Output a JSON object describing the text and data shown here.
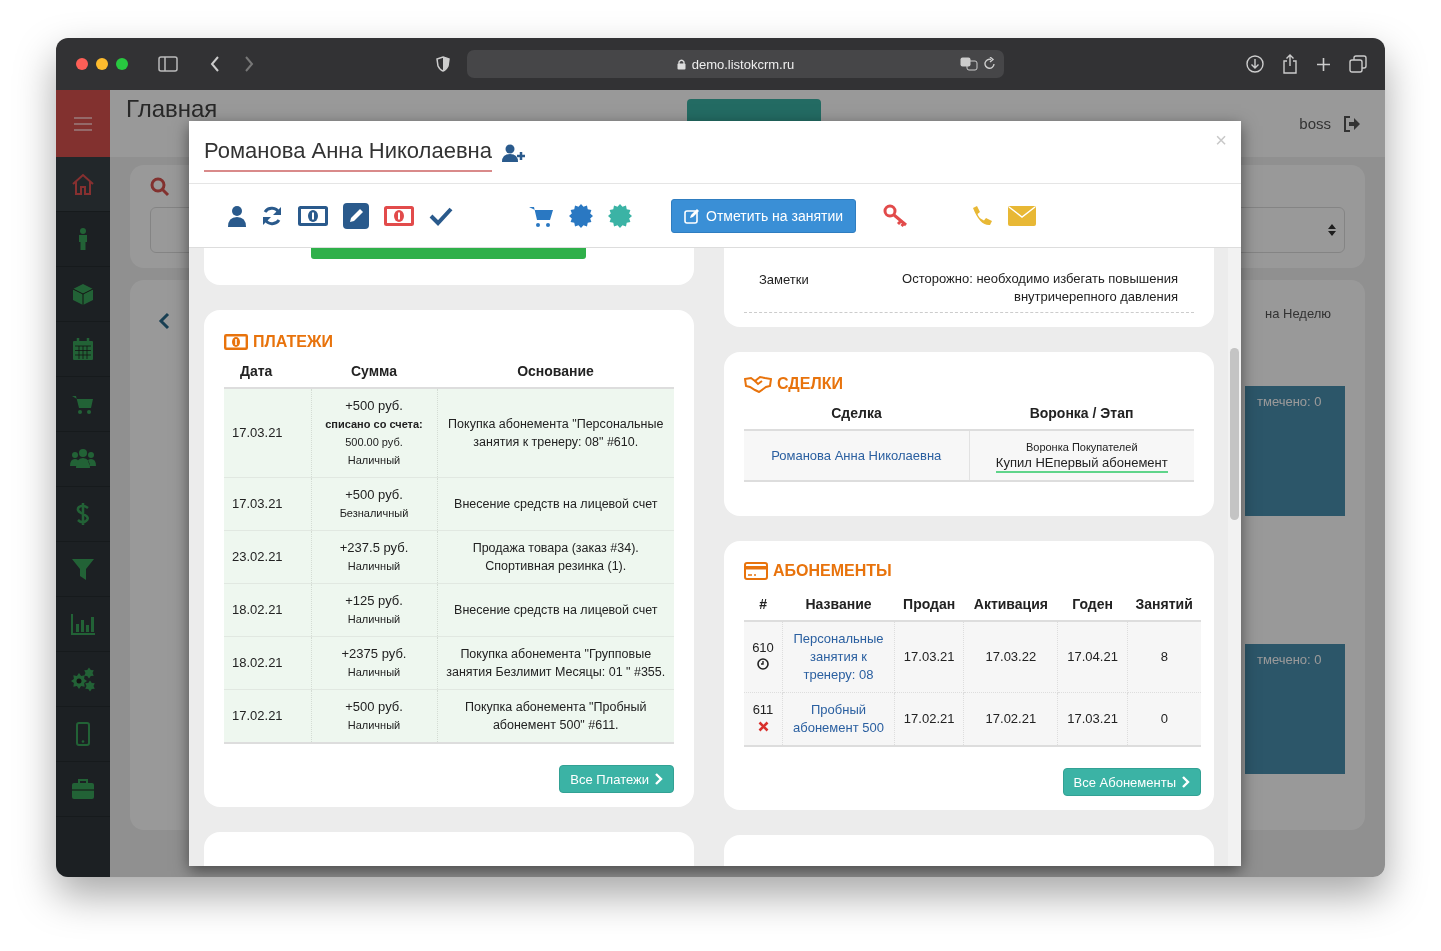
{
  "browser": {
    "url": "demo.listokcrm.ru"
  },
  "app": {
    "page_title": "Главная",
    "user": "boss",
    "week_tab": "на Неделю",
    "slots": [
      {
        "text": "тмечено: 0"
      },
      {
        "text": "тмечено: 0"
      }
    ]
  },
  "sidebar": {
    "items": [
      {
        "kind": "home",
        "selected": true
      },
      {
        "kind": "person",
        "selected": false
      },
      {
        "kind": "cube",
        "selected": false
      },
      {
        "kind": "calendar",
        "selected": false
      },
      {
        "kind": "cart",
        "selected": false
      },
      {
        "kind": "users",
        "selected": false
      },
      {
        "kind": "dollar",
        "selected": false
      },
      {
        "kind": "filter",
        "selected": false
      },
      {
        "kind": "chart",
        "selected": false
      },
      {
        "kind": "gears",
        "selected": false
      },
      {
        "kind": "phone",
        "selected": false
      },
      {
        "kind": "briefcase",
        "selected": false
      }
    ]
  },
  "modal": {
    "title": "Романова Анна Николаевна",
    "close": "×",
    "mark_button": "Отметить на занятии",
    "notes": {
      "label": "Заметки",
      "text": "Осторожно: необходимо избегать повышения внутричерепного давления"
    },
    "payments": {
      "title": "ПЛАТЕЖИ",
      "columns": [
        "Дата",
        "Сумма",
        "Основание"
      ],
      "rows": [
        {
          "date": "17.03.21",
          "amount": "+500 руб.",
          "detail": "**списано со счета:** 500.00 руб.",
          "method": "Наличный",
          "basis": "Покупка абонемента \"Персональные занятия к тренеру: 08\" #610."
        },
        {
          "date": "17.03.21",
          "amount": "+500 руб.",
          "method": "Безналичный",
          "basis": "Внесение средств на лицевой счет"
        },
        {
          "date": "23.02.21",
          "amount": "+237.5 руб.",
          "method": "Наличный",
          "basis": "Продажа товара (заказ #34). Спортивная резинка (1)."
        },
        {
          "date": "18.02.21",
          "amount": "+125 руб.",
          "method": "Наличный",
          "basis": "Внесение средств на лицевой счет"
        },
        {
          "date": "18.02.21",
          "amount": "+2375 руб.",
          "method": "Наличный",
          "basis": "Покупка абонемента \"Групповые занятия Безлимит Месяцы: 01 \" #355."
        },
        {
          "date": "17.02.21",
          "amount": "+500 руб.",
          "method": "Наличный",
          "basis": "Покупка абонемента \"Пробный абонемент 500\" #611."
        }
      ],
      "all_button": "Все Платежи"
    },
    "deals": {
      "title": "СДЕЛКИ",
      "columns": [
        "Сделка",
        "Воронка / Этап"
      ],
      "rows": [
        {
          "deal": "Романова Анна Николаевна",
          "funnel": "Воронка Покупателей",
          "stage": "Купил НЕпервый абонемент"
        }
      ]
    },
    "subscriptions": {
      "title": "АБОНЕМЕНТЫ",
      "columns": [
        "#",
        "Название",
        "Продан",
        "Активация",
        "Годен",
        "Занятий"
      ],
      "rows": [
        {
          "number": "610",
          "kind": "active",
          "name": "Персональные занятия к тренеру: 08",
          "sold": "17.03.21",
          "activated": "17.03.22",
          "valid_until": "17.04.21",
          "sessions": "8"
        },
        {
          "number": "611",
          "kind": "cancelled",
          "name": "Пробный абонемент 500",
          "sold": "17.02.21",
          "activated": "17.02.21",
          "valid_until": "17.03.21",
          "sessions": "0"
        }
      ],
      "all_button": "Все Абонементы"
    }
  }
}
